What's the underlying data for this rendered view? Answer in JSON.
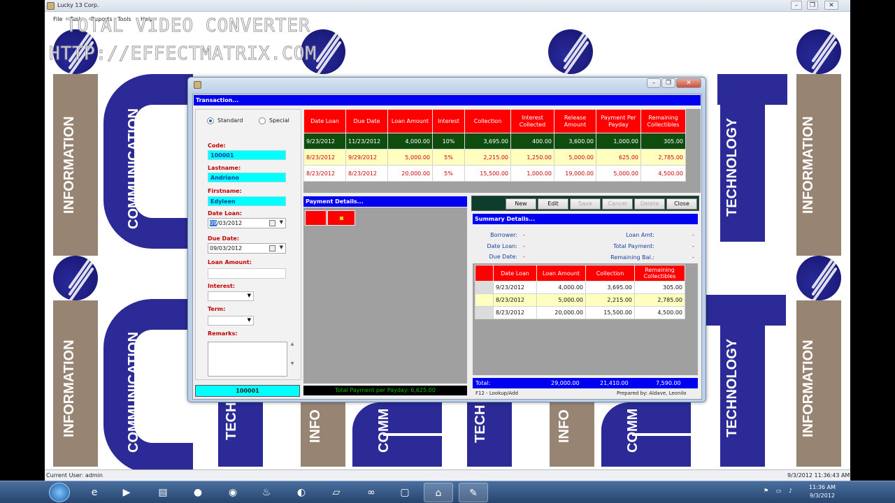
{
  "app": {
    "title": "Lucky 13 Corp.",
    "menu": [
      "File",
      "Task",
      "Reports",
      "Tools",
      "Help"
    ],
    "watermark_line1": "TOTAL VIDEO CONVERTER",
    "watermark_line2": "HTTP://EFFECTMATRIX.COM",
    "bg_words": {
      "information": "INFORMATION",
      "communication": "COMMUNICATION",
      "technology": "TECHNOLOGY",
      "tech_short": "TECH",
      "info_short": "INFO",
      "comm_short": "COMM",
      "comm_short2": "COMM"
    },
    "status_user": "Current User:  admin",
    "status_time": "9/3/2012 11:36:43 AM"
  },
  "dialog": {
    "header": "Transaction...",
    "mode_standard": "Standard",
    "mode_special": "Special",
    "mode_selected": "Standard",
    "code_label": "Code:",
    "code_value": "100001",
    "lastname_label": "Lastname:",
    "lastname_value": "Andriano",
    "firstname_label": "Firstname:",
    "firstname_value": "Edyleen",
    "date_loan_label": "Date Loan:",
    "date_loan_sel": "09",
    "date_loan_rest": "/03/2012",
    "due_date_label": "Due Date:",
    "due_date_value": "09/03/2012",
    "loan_amount_label": "Loan Amount:",
    "interest_label": "Interest:",
    "term_label": "Term:",
    "remarks_label": "Remarks:",
    "code_bar": "100001",
    "payment_header": "Payment Details...",
    "payment_total": "Total Payment per Payday: 6,625.00",
    "summary_header": "Summary Details...",
    "buttons": {
      "new": "New",
      "edit": "Edit",
      "save": "Save",
      "cancel": "Cancel",
      "delete": "Delete",
      "close": "Close"
    },
    "summary": {
      "borrower_label": "Borrower:",
      "borrower_value": "-",
      "date_loan_label": "Date Loan:",
      "date_loan_value": "-",
      "due_date_label": "Due Date:",
      "due_date_value": "-",
      "loan_amt_label": "Loan Amt:",
      "loan_amt_value": "-",
      "total_payment_label": "Total Payment:",
      "total_payment_value": "-",
      "remaining_label": "Remaining Bal.:",
      "remaining_value": "-"
    },
    "totals": {
      "label": "Total:",
      "loan": "29,000.00",
      "collection": "21,410.00",
      "remaining": "7,590.00"
    },
    "footer_hint": "F12 - Lookup/Add",
    "footer_prepared": "Prepared by: Aldave, Leonilo"
  },
  "loans_table": {
    "headers": [
      "Date Loan",
      "Due Date",
      "Loan Amount",
      "Interest",
      "Collection",
      "Interest Collected",
      "Release Amount",
      "Payment Per Payday",
      "Remaining Collectibles"
    ],
    "rows": [
      [
        "9/23/2012",
        "11/23/2012",
        "4,000.00",
        "10%",
        "3,695.00",
        "400.00",
        "3,600.00",
        "1,000.00",
        "305.00"
      ],
      [
        "8/23/2012",
        "9/29/2012",
        "5,000.00",
        "5%",
        "2,215.00",
        "1,250.00",
        "5,000.00",
        "625.00",
        "2,785.00"
      ],
      [
        "8/23/2012",
        "8/23/2012",
        "20,000.00",
        "5%",
        "15,500.00",
        "1,000.00",
        "19,000.00",
        "5,000.00",
        "4,500.00"
      ]
    ]
  },
  "summary_table": {
    "headers": [
      "Date Loan",
      "Loan Amount",
      "Collection",
      "Remaining Collectibles"
    ],
    "rows": [
      [
        "9/23/2012",
        "4,000.00",
        "3,695.00",
        "305.00"
      ],
      [
        "8/23/2012",
        "5,000.00",
        "2,215.00",
        "2,785.00"
      ],
      [
        "8/23/2012",
        "20,000.00",
        "15,500.00",
        "4,500.00"
      ]
    ]
  },
  "taskbar": {
    "clock_time": "11:36 AM",
    "clock_date": "9/3/2012",
    "icons": [
      "ie-icon",
      "media-player-icon",
      "explorer-icon",
      "firefox-icon",
      "chrome-icon",
      "burn-icon",
      "app-icon",
      "notepad-icon",
      "infinity-icon",
      "window-icon",
      "network-icon",
      "lucky13-icon"
    ]
  }
}
